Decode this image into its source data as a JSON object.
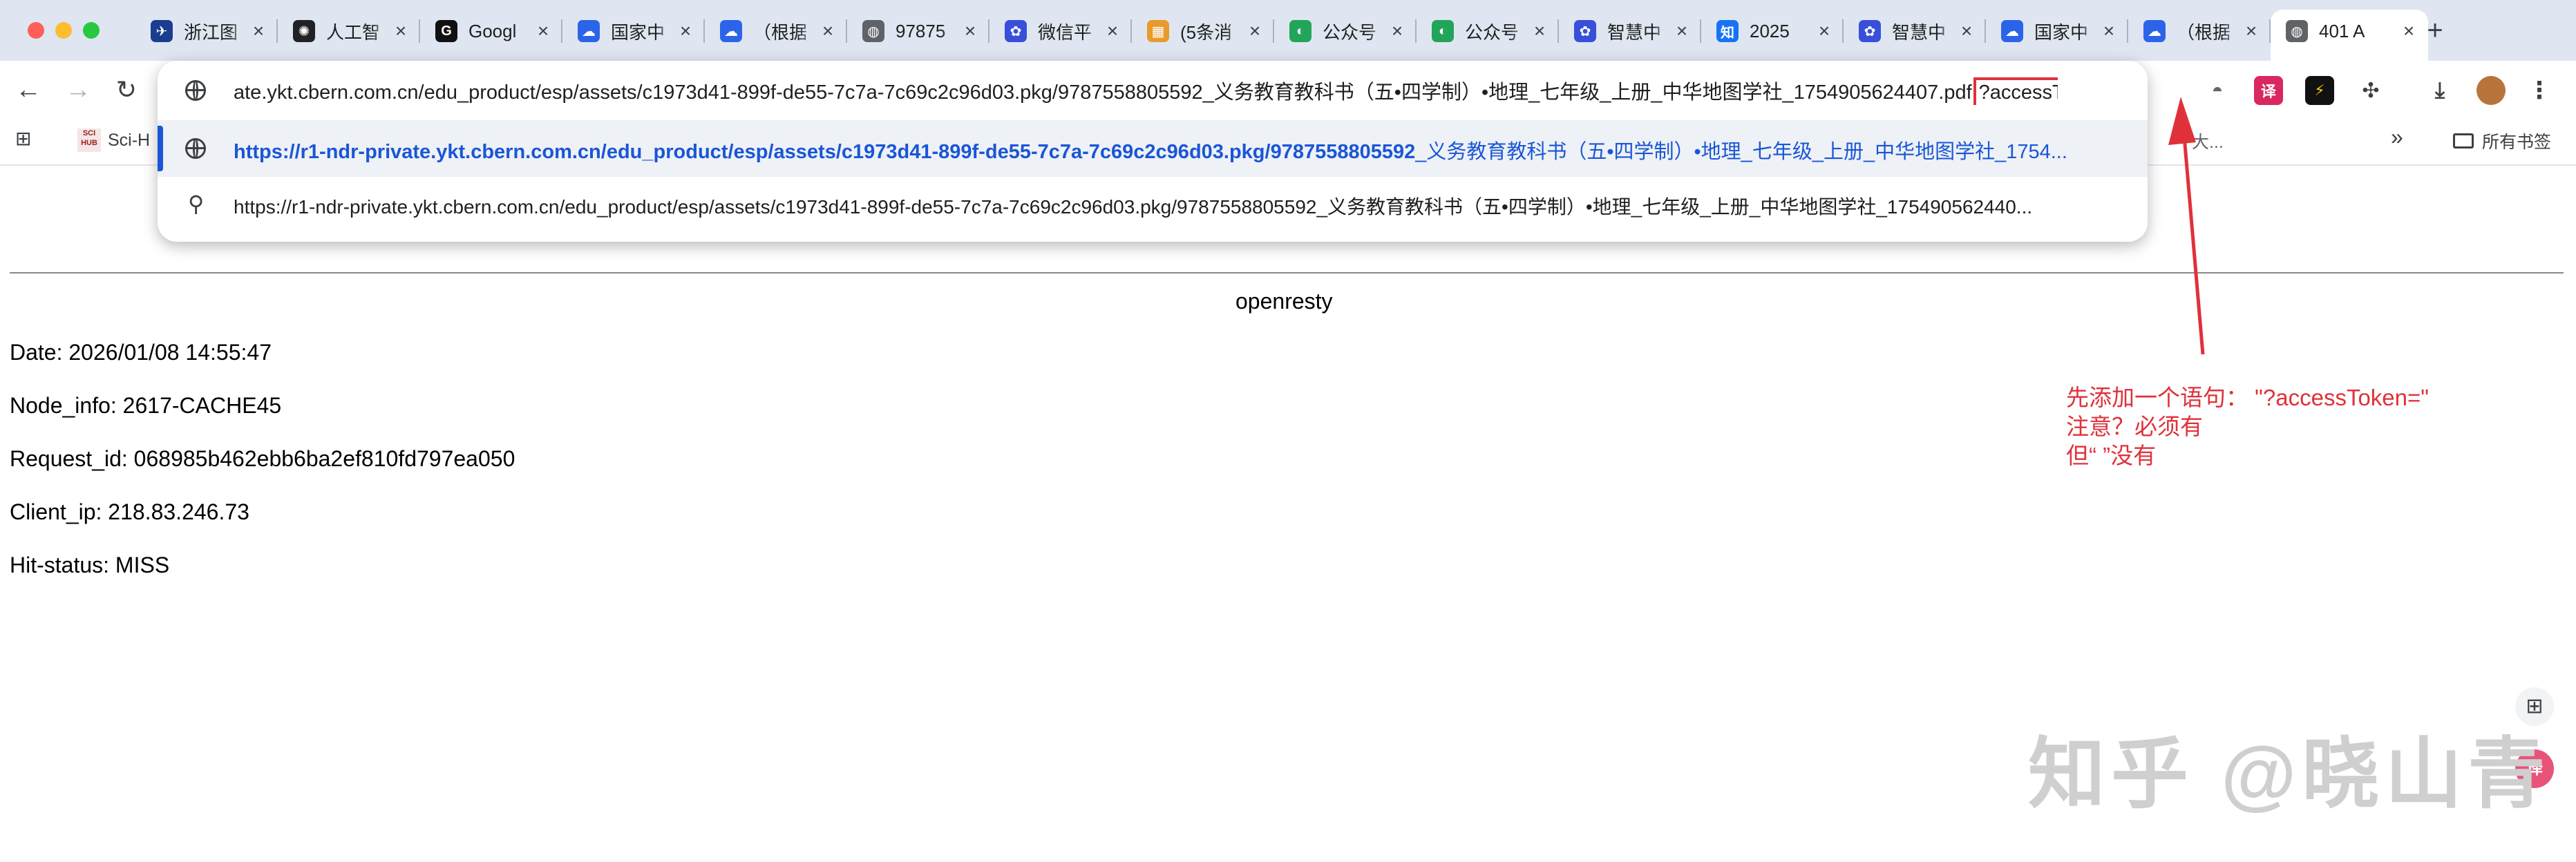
{
  "tabs": [
    {
      "title": "浙江图",
      "icon": "bookmark-blue-icon",
      "color": "#1a3d8f",
      "glyph": "✈"
    },
    {
      "title": "人工智",
      "icon": "openai-icon",
      "color": "#202124",
      "glyph": "✺"
    },
    {
      "title": "Googl",
      "icon": "google-dark-icon",
      "color": "#111111",
      "glyph": "G"
    },
    {
      "title": "国家中",
      "icon": "cloud-blue-icon",
      "color": "#2c64e9",
      "glyph": "☁"
    },
    {
      "title": "（根据",
      "icon": "cloud-blue-icon",
      "color": "#2c64e9",
      "glyph": "☁"
    },
    {
      "title": "97875",
      "icon": "globe-icon",
      "color": "#5f6368",
      "glyph": "◍"
    },
    {
      "title": "微信平",
      "icon": "paw-icon",
      "color": "#3850d9",
      "glyph": "✿"
    },
    {
      "title": "(5条消",
      "icon": "colorful-grid-icon",
      "color": "#e89a2c",
      "glyph": "▦"
    },
    {
      "title": "公众号",
      "icon": "green-spiral-icon",
      "color": "#22a55a",
      "glyph": "◐"
    },
    {
      "title": "公众号",
      "icon": "green-spiral-icon",
      "color": "#22a55a",
      "glyph": "◐"
    },
    {
      "title": "智慧中",
      "icon": "paw-icon",
      "color": "#3850d9",
      "glyph": "✿"
    },
    {
      "title": "2025",
      "icon": "zhihu-icon",
      "color": "#1772f6",
      "glyph": "知"
    },
    {
      "title": "智慧中",
      "icon": "paw-icon",
      "color": "#3850d9",
      "glyph": "✿"
    },
    {
      "title": "国家中",
      "icon": "cloud-blue-icon",
      "color": "#2c64e9",
      "glyph": "☁"
    },
    {
      "title": "（根据",
      "icon": "cloud-blue-icon",
      "color": "#2c64e9",
      "glyph": "☁"
    },
    {
      "title": "401 A",
      "icon": "globe-icon",
      "color": "#5f6368",
      "glyph": "◍",
      "active": true
    }
  ],
  "toolbar": {
    "address_text": "ate.ykt.cbern.com.cn/edu_product/esp/assets/c1973d41-899f-de55-7c7a-7c69c2c96d03.pkg/9787558805592_义务教育教科书（五•四学制）•地理_七年级_上册_中华地图学社_1754905624407.pdf",
    "address_highlight": "?accessToken="
  },
  "omnibox": {
    "suggestion_1_bold": "https://r1-ndr-private.ykt.cbern.com.cn/edu_product/esp/assets/c1973d41-899f-de55-7c7a-7c69c2c96d03.pkg/9787558805592",
    "suggestion_1_rest": "_义务教育教科书（五•四学制）•地理_七年级_上册_中华地图学社_1754...",
    "suggestion_2": "https://r1-ndr-private.ykt.cbern.com.cn/edu_product/esp/assets/c1973d41-899f-de55-7c7a-7c69c2c96d03.pkg/9787558805592_义务教育教科书（五•四学制）•地理_七年级_上册_中华地图学社_175490562440..."
  },
  "bookmarks": {
    "first": "Sci-H",
    "overflow": "»",
    "all": "所有书签",
    "partial": "大..."
  },
  "page": {
    "server": "openresty",
    "date": "Date: 2026/01/08 14:55:47",
    "node": "Node_info: 2617-CACHE45",
    "request": "Request_id: 068985b462ebb6ba2ef810fd797ea050",
    "client": "Client_ip: 218.83.246.73",
    "hit": "Hit-status: MISS"
  },
  "annotation": {
    "line1": "先添加一个语句：  \"?accessToken=\"",
    "line2": "注意？必须有",
    "line3": "但“ ”没有",
    "color": "#e0313a"
  },
  "watermark": "知乎 @晓山青",
  "colors": {
    "accent": "#1a56d6",
    "tabstrip": "#dfe6f1"
  }
}
